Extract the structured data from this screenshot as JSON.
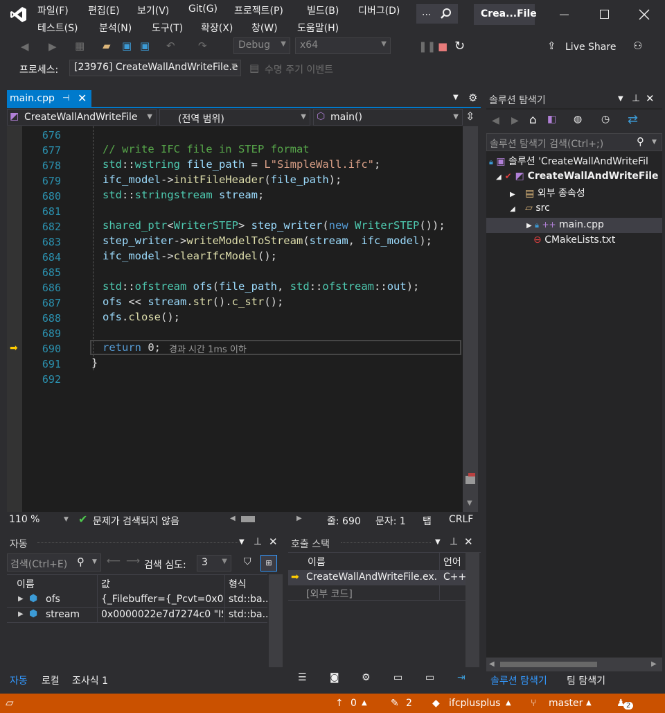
{
  "title": {
    "text": "Crea...File",
    "search_label": "..."
  },
  "menu": {
    "row1": [
      "파일(F)",
      "편집(E)",
      "보기(V)",
      "Git(G)",
      "프로젝트(P)",
      "빌드(B)",
      "디버그(D)"
    ],
    "row2": [
      "테스트(S)",
      "분석(N)",
      "도구(T)",
      "확장(X)",
      "창(W)",
      "도움말(H)"
    ]
  },
  "toolbar": {
    "config": "Debug",
    "platform": "x64",
    "live_share": "Live Share",
    "process_label": "프로세스:",
    "process_value": "[23976] CreateWallAndWriteFile.e",
    "lifecycle": "수명 주기 이벤트"
  },
  "editor": {
    "tab_label": "main.cpp",
    "nav_project": "CreateWallAndWriteFile",
    "nav_scope": "(전역 범위)",
    "nav_function": "main()",
    "line_numbers": [
      "676",
      "677",
      "678",
      "679",
      "680",
      "681",
      "682",
      "683",
      "684",
      "685",
      "686",
      "687",
      "688",
      "689",
      "690",
      "691",
      "692"
    ],
    "inline_hint": "경과 시간 1ms 이하",
    "zoom": "110 %",
    "issues": "문제가 검색되지 않음",
    "line": "줄: 690",
    "col": "문자: 1",
    "tab": "탭",
    "eol": "CRLF"
  },
  "autos": {
    "title": "자동",
    "search_placeholder": "검색(Ctrl+E)",
    "depth_label": "검색 심도:",
    "depth_value": "3",
    "columns": [
      "이름",
      "값",
      "형식"
    ],
    "rows": [
      {
        "name": "ofs",
        "value": "{_Filebuffer={_Pcvt=0x00...",
        "type": "std::ba..."
      },
      {
        "name": "stream",
        "value": "0x0000022e7d7274c0 \"IS...",
        "type": "std::ba..."
      }
    ],
    "tabs": [
      "자동",
      "로컬",
      "조사식 1"
    ]
  },
  "callstack": {
    "title": "호출 스택",
    "columns": [
      "이름",
      "언어"
    ],
    "rows": [
      {
        "name": "CreateWallAndWriteFile.ex...",
        "lang": "C++"
      },
      {
        "name": "[외부 코드]",
        "lang": ""
      }
    ]
  },
  "solution": {
    "title": "솔루션 탐색기",
    "search_placeholder": "솔루션 탐색기 검색(Ctrl+;)",
    "items": [
      {
        "label": "솔루션 'CreateWallAndWriteFil"
      },
      {
        "label": "CreateWallAndWriteFile"
      },
      {
        "label": "외부 종속성"
      },
      {
        "label": "src"
      },
      {
        "label": "main.cpp"
      },
      {
        "label": "CMakeLists.txt"
      }
    ],
    "tabs": [
      "솔루션 탐색기",
      "팀 탐색기"
    ]
  },
  "statusbar": {
    "up_count": "0",
    "edit_count": "2",
    "repo": "ifcplusplus",
    "branch": "master",
    "notifications": "2"
  },
  "colors": {
    "accent": "#007acc",
    "status": "#ca5100",
    "editor_bg": "#1e1e1e"
  }
}
